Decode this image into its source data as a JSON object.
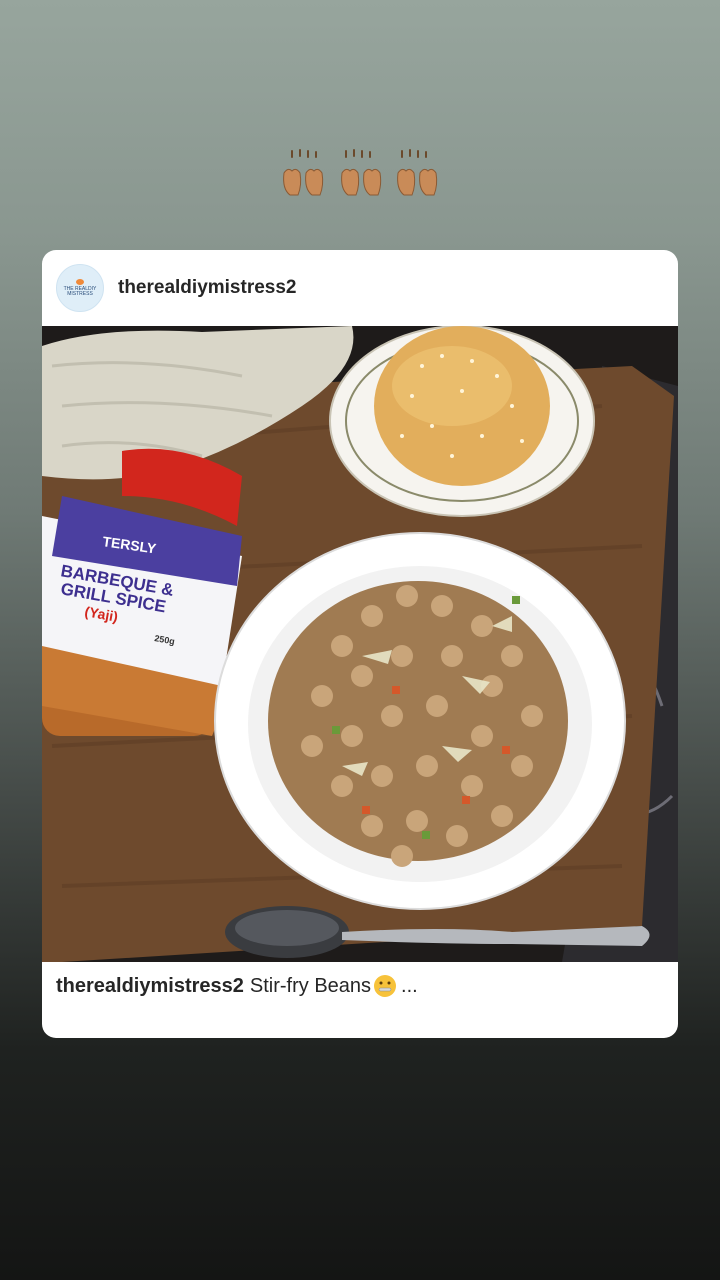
{
  "story": {
    "sticker_icon": "clapping-hands-icon",
    "post": {
      "avatar_text": "THE REALDIY MISTRESS",
      "username": "therealdiymistress2",
      "image_alt": "Stir-fry beans in a white bowl beside a sesame bun and a jar of spice",
      "jar_label": {
        "brand": "TERSLY",
        "line1": "BARBEQUE &",
        "line2": "GRILL SPICE",
        "line3": "(Yaji)",
        "weight": "250g"
      },
      "caption": {
        "username": "therealdiymistress2",
        "text": "Stir-fry Beans",
        "emoji_icon": "zipper-mouth-face-icon",
        "ellipsis": "..."
      }
    }
  },
  "colors": {
    "bg_top": "#97a59d",
    "bg_bottom": "#141514",
    "card": "#ffffff",
    "text": "#262626"
  }
}
